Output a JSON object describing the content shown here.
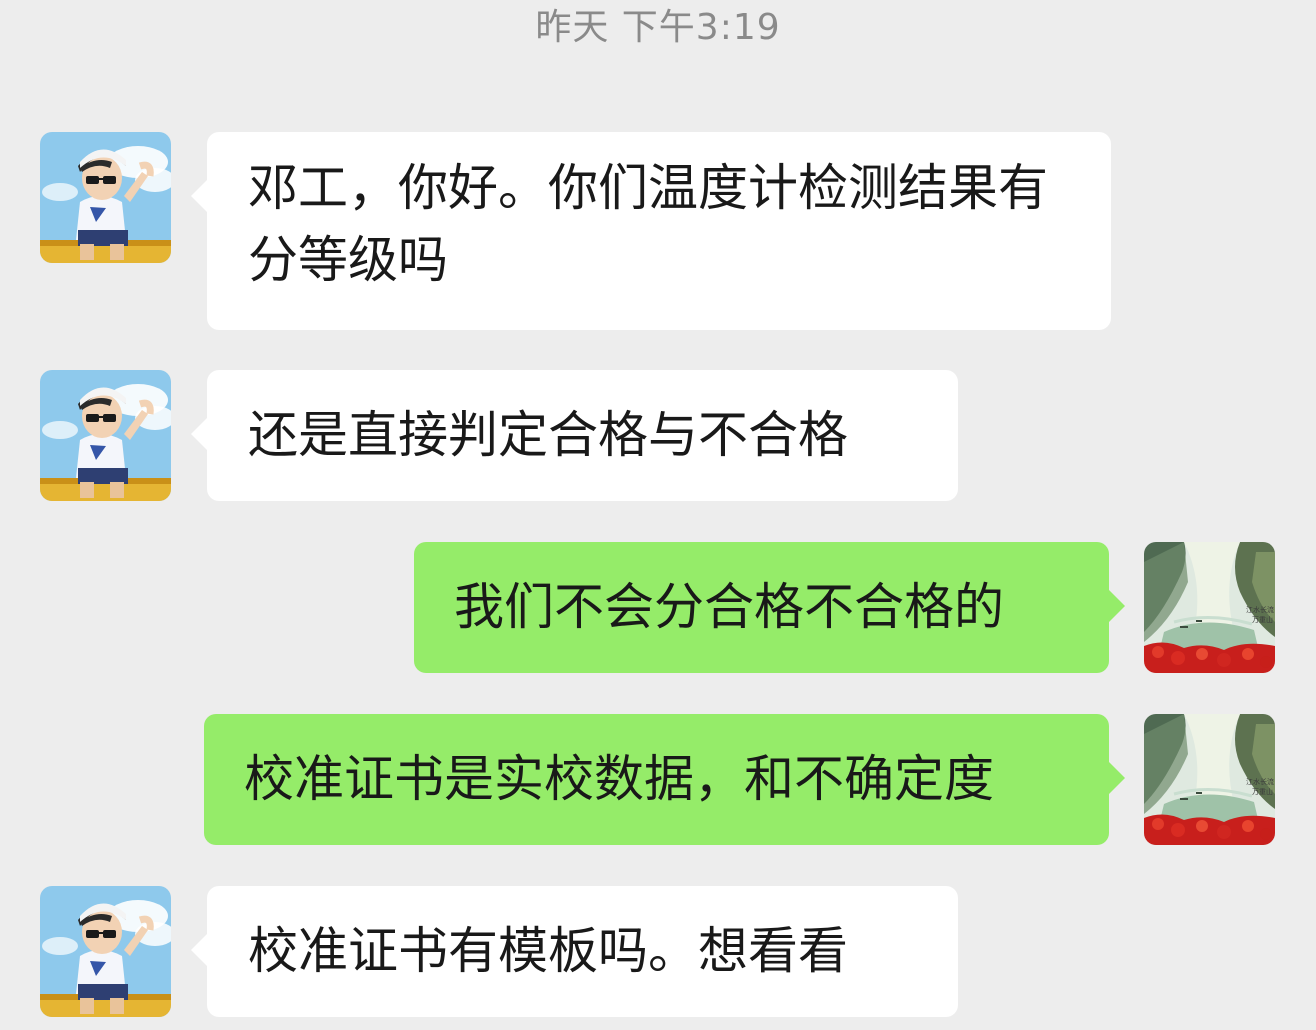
{
  "timestamp": "昨天 下午3:19",
  "contact_avatar": {
    "icon": "boy-with-cap-avatar-icon",
    "sky_color": "#8ec9ec",
    "shirt_color": "#ffffff",
    "cap_color": "#2b2b2b"
  },
  "self_avatar": {
    "icon": "river-gorge-landscape-avatar-icon",
    "calligraphy": "江水长流 万重山"
  },
  "colors": {
    "background": "#ededed",
    "incoming_bubble": "#ffffff",
    "outgoing_bubble": "#95ec69",
    "timestamp": "#8a8a8a"
  },
  "messages": [
    {
      "direction": "incoming",
      "text": "邓工，你好。你们温度计检测结果有分等级吗"
    },
    {
      "direction": "incoming",
      "text": "还是直接判定合格与不合格"
    },
    {
      "direction": "outgoing",
      "text": "我们不会分合格不合格的"
    },
    {
      "direction": "outgoing",
      "text": "校准证书是实校数据，和不确定度"
    },
    {
      "direction": "incoming",
      "text": "校准证书有模板吗。想看看"
    }
  ]
}
